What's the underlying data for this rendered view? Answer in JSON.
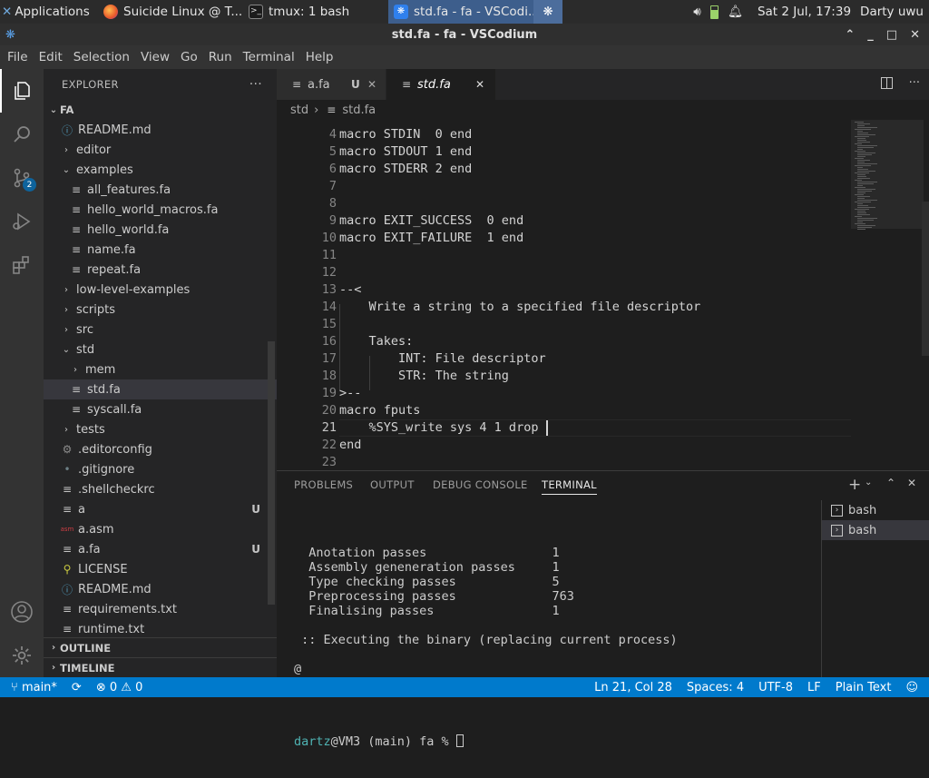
{
  "taskbar": {
    "apps_label": "Applications",
    "windows": [
      "Suicide Linux @ T...",
      "tmux: 1 bash",
      "std.fa - fa - VSCodi..."
    ],
    "clock": "Sat  2 Jul, 17:39",
    "user": "Darty uwu"
  },
  "window": {
    "title": "std.fa - fa - VSCodium"
  },
  "menu": [
    "File",
    "Edit",
    "Selection",
    "View",
    "Go",
    "Run",
    "Terminal",
    "Help"
  ],
  "sidebar": {
    "header": "EXPLORER",
    "more": "···",
    "root": "FA",
    "items": [
      {
        "label": "README.md",
        "icon": "info-icon",
        "chev": "",
        "u": ""
      },
      {
        "label": "editor",
        "icon": "",
        "chev": "›",
        "u": ""
      },
      {
        "label": "examples",
        "icon": "",
        "chev": "⌄",
        "u": ""
      },
      {
        "label": "all_features.fa",
        "icon": "lines-icon",
        "chev": "",
        "u": ""
      },
      {
        "label": "hello_world_macros.fa",
        "icon": "lines-icon",
        "chev": "",
        "u": ""
      },
      {
        "label": "hello_world.fa",
        "icon": "lines-icon",
        "chev": "",
        "u": ""
      },
      {
        "label": "name.fa",
        "icon": "lines-icon",
        "chev": "",
        "u": ""
      },
      {
        "label": "repeat.fa",
        "icon": "lines-icon",
        "chev": "",
        "u": ""
      },
      {
        "label": "low-level-examples",
        "icon": "",
        "chev": "›",
        "u": ""
      },
      {
        "label": "scripts",
        "icon": "",
        "chev": "›",
        "u": ""
      },
      {
        "label": "src",
        "icon": "",
        "chev": "›",
        "u": ""
      },
      {
        "label": "std",
        "icon": "",
        "chev": "⌄",
        "u": ""
      },
      {
        "label": "mem",
        "icon": "",
        "chev": "›",
        "u": ""
      },
      {
        "label": "std.fa",
        "icon": "lines-icon",
        "chev": "",
        "u": ""
      },
      {
        "label": "syscall.fa",
        "icon": "lines-icon",
        "chev": "",
        "u": ""
      },
      {
        "label": "tests",
        "icon": "",
        "chev": "›",
        "u": ""
      },
      {
        "label": ".editorconfig",
        "icon": "gear-icon",
        "chev": "",
        "u": ""
      },
      {
        "label": ".gitignore",
        "icon": "dot-icon",
        "chev": "",
        "u": ""
      },
      {
        "label": ".shellcheckrc",
        "icon": "lines-icon",
        "chev": "",
        "u": ""
      },
      {
        "label": "a",
        "icon": "lines-icon",
        "chev": "",
        "u": "U"
      },
      {
        "label": "a.asm",
        "icon": "asm-icon",
        "chev": "",
        "u": ""
      },
      {
        "label": "a.fa",
        "icon": "lines-icon",
        "chev": "",
        "u": "U"
      },
      {
        "label": "LICENSE",
        "icon": "license-icon",
        "chev": "",
        "u": ""
      },
      {
        "label": "README.md",
        "icon": "info-icon",
        "chev": "",
        "u": ""
      },
      {
        "label": "requirements.txt",
        "icon": "lines-icon",
        "chev": "",
        "u": ""
      },
      {
        "label": "runtime.txt",
        "icon": "lines-icon",
        "chev": "",
        "u": ""
      }
    ],
    "outline": "OUTLINE",
    "timeline": "TIMELINE"
  },
  "activity": {
    "scm_badge": "2"
  },
  "tabs": [
    {
      "label": "a.fa",
      "status": "U"
    },
    {
      "label": "std.fa",
      "status": ""
    }
  ],
  "breadcrumb": {
    "folder": "std",
    "file": "std.fa"
  },
  "code": [
    {
      "n": "4",
      "t": "macro STDIN  0 end"
    },
    {
      "n": "5",
      "t": "macro STDOUT 1 end"
    },
    {
      "n": "6",
      "t": "macro STDERR 2 end"
    },
    {
      "n": "7",
      "t": ""
    },
    {
      "n": "8",
      "t": ""
    },
    {
      "n": "9",
      "t": "macro EXIT_SUCCESS  0 end"
    },
    {
      "n": "10",
      "t": "macro EXIT_FAILURE  1 end"
    },
    {
      "n": "11",
      "t": ""
    },
    {
      "n": "12",
      "t": ""
    },
    {
      "n": "13",
      "t": "--<"
    },
    {
      "n": "14",
      "t": "    Write a string to a specified file descriptor"
    },
    {
      "n": "15",
      "t": ""
    },
    {
      "n": "16",
      "t": "    Takes:"
    },
    {
      "n": "17",
      "t": "        INT: File descriptor"
    },
    {
      "n": "18",
      "t": "        STR: The string"
    },
    {
      "n": "19",
      "t": ">--"
    },
    {
      "n": "20",
      "t": "macro fputs"
    },
    {
      "n": "21",
      "t": "    %SYS_write sys 4 1 drop"
    },
    {
      "n": "22",
      "t": "end"
    },
    {
      "n": "23",
      "t": ""
    }
  ],
  "panel": {
    "tabs": [
      "PROBLEMS",
      "OUTPUT",
      "DEBUG CONSOLE",
      "TERMINAL"
    ],
    "terminal_lines": [
      "  Anotation passes                 1",
      "  Assembly geneneration passes     1",
      "  Type checking passes             5",
      "  Preprocessing passes             763",
      "  Finalising passes                1",
      "",
      " :: Executing the binary (replacing current process)",
      "",
      "@",
      ""
    ],
    "prompt_user": "dartz",
    "prompt_rest": "@VM3 (main) fa % ",
    "terminals": [
      "bash",
      "bash"
    ]
  },
  "status": {
    "branch": "main*",
    "errors": "0",
    "warnings": "0",
    "position": "Ln 21, Col 28",
    "spaces": "Spaces: 4",
    "encoding": "UTF-8",
    "eol": "LF",
    "language": "Plain Text"
  },
  "colors": {
    "accent": "#007acc",
    "badge": "#0e639c",
    "prompt_user": "#4fb3b3"
  }
}
